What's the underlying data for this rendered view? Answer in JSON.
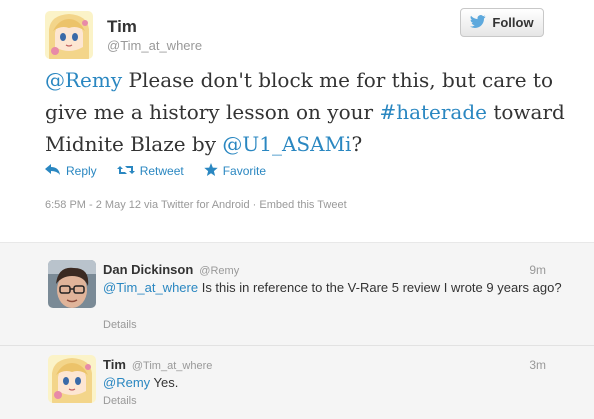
{
  "tweet": {
    "author_name": "Tim",
    "author_handle": "@Tim_at_where",
    "follow_label": "Follow",
    "text": {
      "mention1": "@Remy",
      "part1": " Please don't block me for this, but care to give me a history lesson on your ",
      "hashtag": "#haterade",
      "part2": " toward Midnite Blaze by ",
      "mention2": "@U1_ASAMi",
      "part3": "?"
    },
    "actions": {
      "reply": "Reply",
      "retweet": "Retweet",
      "favorite": "Favorite"
    },
    "meta": {
      "timestamp": "6:58 PM - 2 May 12 via Twitter for Android",
      "separator": " · ",
      "embed": "Embed this Tweet"
    }
  },
  "replies": [
    {
      "name": "Dan Dickinson",
      "handle": "@Remy",
      "time": "9m",
      "mention": "@Tim_at_where",
      "text": " Is this in reference to the V-Rare 5 review I wrote 9 years ago?",
      "details": "Details"
    },
    {
      "name": "Tim",
      "handle": "@Tim_at_where",
      "time": "3m",
      "mention": "@Remy",
      "text": " Yes.",
      "details": "Details"
    }
  ],
  "colors": {
    "link": "#2a87c1",
    "twitter_blue": "#5ea9dd",
    "muted": "#999999"
  },
  "icons": [
    "anime-avatar",
    "twitter-bird-icon",
    "reply-arrow-icon",
    "retweet-icon",
    "star-icon",
    "person-avatar"
  ]
}
